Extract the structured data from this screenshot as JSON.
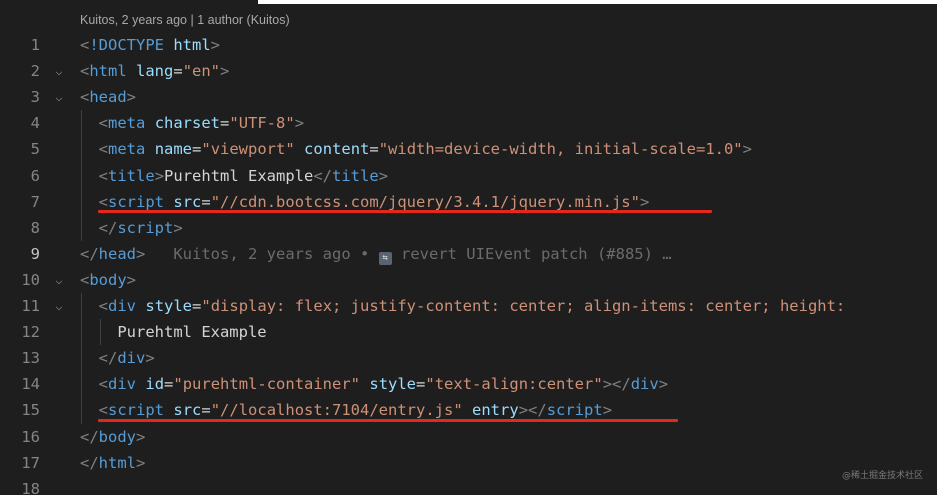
{
  "codelens": "Kuitos, 2 years ago | 1 author (Kuitos)",
  "blame": {
    "text_before": "Kuitos, 2 years ago • ",
    "icon": "commit-icon",
    "text_after": " revert UIEvent patch (#885) …"
  },
  "lines": [
    {
      "num": "1",
      "parts": [
        [
          "punct",
          "<"
        ],
        [
          "tag",
          "!DOCTYPE"
        ],
        [
          "text",
          " "
        ],
        [
          "attr",
          "html"
        ],
        [
          "punct",
          ">"
        ]
      ]
    },
    {
      "num": "2",
      "parts": [
        [
          "punct",
          "<"
        ],
        [
          "tag",
          "html"
        ],
        [
          "text",
          " "
        ],
        [
          "attr",
          "lang"
        ],
        [
          "eq",
          "="
        ],
        [
          "str",
          "\"en\""
        ],
        [
          "punct",
          ">"
        ]
      ]
    },
    {
      "num": "3",
      "parts": [
        [
          "punct",
          "<"
        ],
        [
          "tag",
          "head"
        ],
        [
          "punct",
          ">"
        ]
      ]
    },
    {
      "num": "4",
      "parts": [
        [
          "text",
          "  "
        ],
        [
          "punct",
          "<"
        ],
        [
          "tag",
          "meta"
        ],
        [
          "text",
          " "
        ],
        [
          "attr",
          "charset"
        ],
        [
          "eq",
          "="
        ],
        [
          "str",
          "\"UTF-8\""
        ],
        [
          "punct",
          ">"
        ]
      ]
    },
    {
      "num": "5",
      "parts": [
        [
          "text",
          "  "
        ],
        [
          "punct",
          "<"
        ],
        [
          "tag",
          "meta"
        ],
        [
          "text",
          " "
        ],
        [
          "attr",
          "name"
        ],
        [
          "eq",
          "="
        ],
        [
          "str",
          "\"viewport\""
        ],
        [
          "text",
          " "
        ],
        [
          "attr",
          "content"
        ],
        [
          "eq",
          "="
        ],
        [
          "str",
          "\"width=device-width, initial-scale=1.0\""
        ],
        [
          "punct",
          ">"
        ]
      ]
    },
    {
      "num": "6",
      "parts": [
        [
          "text",
          "  "
        ],
        [
          "punct",
          "<"
        ],
        [
          "tag",
          "title"
        ],
        [
          "punct",
          ">"
        ],
        [
          "text",
          "Purehtml Example"
        ],
        [
          "punct",
          "</"
        ],
        [
          "tag",
          "title"
        ],
        [
          "punct",
          ">"
        ]
      ]
    },
    {
      "num": "7",
      "parts": [
        [
          "text",
          "  "
        ],
        [
          "punct",
          "<"
        ],
        [
          "tag",
          "script"
        ],
        [
          "text",
          " "
        ],
        [
          "attr",
          "src"
        ],
        [
          "eq",
          "="
        ],
        [
          "str",
          "\"//cdn.bootcss.com/jquery/3.4.1/jquery.min.js\""
        ],
        [
          "punct",
          ">"
        ]
      ]
    },
    {
      "num": "8",
      "parts": [
        [
          "text",
          "  "
        ],
        [
          "punct",
          "</"
        ],
        [
          "tag",
          "script"
        ],
        [
          "punct",
          ">"
        ]
      ]
    },
    {
      "num": "9",
      "parts": [
        [
          "punct",
          "</"
        ],
        [
          "tag",
          "head"
        ],
        [
          "punct",
          ">"
        ]
      ],
      "blame": true
    },
    {
      "num": "10",
      "parts": [
        [
          "punct",
          "<"
        ],
        [
          "tag",
          "body"
        ],
        [
          "punct",
          ">"
        ]
      ]
    },
    {
      "num": "11",
      "parts": [
        [
          "text",
          "  "
        ],
        [
          "punct",
          "<"
        ],
        [
          "tag",
          "div"
        ],
        [
          "text",
          " "
        ],
        [
          "attr",
          "style"
        ],
        [
          "eq",
          "="
        ],
        [
          "str",
          "\"display: flex; justify-content: center; align-items: center; height:"
        ]
      ]
    },
    {
      "num": "12",
      "parts": [
        [
          "text",
          "    Purehtml Example"
        ]
      ]
    },
    {
      "num": "13",
      "parts": [
        [
          "text",
          "  "
        ],
        [
          "punct",
          "</"
        ],
        [
          "tag",
          "div"
        ],
        [
          "punct",
          ">"
        ]
      ]
    },
    {
      "num": "14",
      "parts": [
        [
          "text",
          "  "
        ],
        [
          "punct",
          "<"
        ],
        [
          "tag",
          "div"
        ],
        [
          "text",
          " "
        ],
        [
          "attr",
          "id"
        ],
        [
          "eq",
          "="
        ],
        [
          "str",
          "\"purehtml-container\""
        ],
        [
          "text",
          " "
        ],
        [
          "attr",
          "style"
        ],
        [
          "eq",
          "="
        ],
        [
          "str",
          "\"text-align:center\""
        ],
        [
          "punct",
          "></"
        ],
        [
          "tag",
          "div"
        ],
        [
          "punct",
          ">"
        ]
      ]
    },
    {
      "num": "15",
      "parts": [
        [
          "text",
          "  "
        ],
        [
          "punct",
          "<"
        ],
        [
          "tag",
          "script"
        ],
        [
          "text",
          " "
        ],
        [
          "attr",
          "src"
        ],
        [
          "eq",
          "="
        ],
        [
          "str",
          "\"//localhost:7104/entry.js\""
        ],
        [
          "text",
          " "
        ],
        [
          "attr",
          "entry"
        ],
        [
          "punct",
          "></"
        ],
        [
          "tag",
          "script"
        ],
        [
          "punct",
          ">"
        ]
      ]
    },
    {
      "num": "16",
      "parts": [
        [
          "punct",
          "</"
        ],
        [
          "tag",
          "body"
        ],
        [
          "punct",
          ">"
        ]
      ]
    },
    {
      "num": "17",
      "parts": [
        [
          "punct",
          "</"
        ],
        [
          "tag",
          "html"
        ],
        [
          "punct",
          ">"
        ]
      ]
    },
    {
      "num": "18",
      "parts": []
    }
  ],
  "watermark": "@稀土掘金技术社区",
  "colors": {
    "background": "#1e1e1e",
    "tag": "#569cd6",
    "attribute": "#9cdcfe",
    "string": "#ce9178",
    "underline": "#e5281e"
  }
}
